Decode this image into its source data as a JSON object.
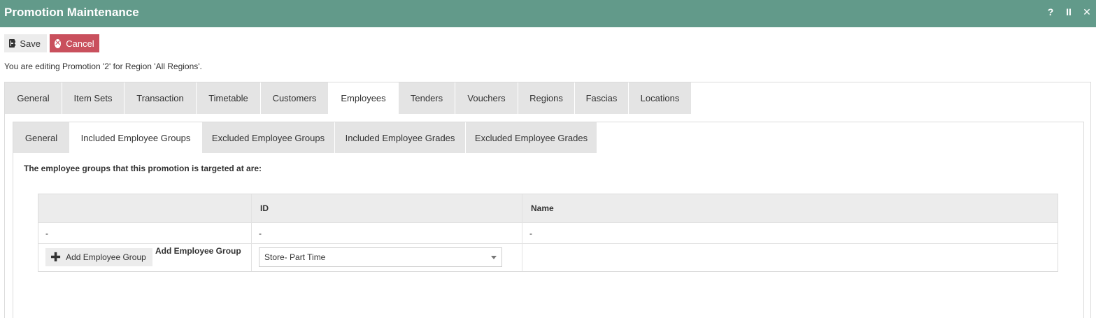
{
  "window": {
    "title": "Promotion Maintenance",
    "controls": [
      {
        "name": "help-icon",
        "glyph": "?"
      },
      {
        "name": "pause-icon",
        "glyph": "II"
      },
      {
        "name": "close-icon",
        "glyph": "✕"
      }
    ]
  },
  "toolbar": {
    "save_label": "Save",
    "save_icon": "floppy-disk-icon",
    "cancel_label": "Cancel",
    "cancel_icon": "x-circle-icon"
  },
  "notice": "You are editing Promotion '2' for Region 'All Regions'.",
  "tabs": {
    "items": [
      {
        "label": "General"
      },
      {
        "label": "Item Sets"
      },
      {
        "label": "Transaction"
      },
      {
        "label": "Timetable"
      },
      {
        "label": "Customers"
      },
      {
        "label": "Employees"
      },
      {
        "label": "Tenders"
      },
      {
        "label": "Vouchers"
      },
      {
        "label": "Regions"
      },
      {
        "label": "Fascias"
      },
      {
        "label": "Locations"
      }
    ],
    "active": "Employees"
  },
  "subtabs": {
    "items": [
      {
        "label": "General"
      },
      {
        "label": "Included Employee Groups"
      },
      {
        "label": "Excluded Employee Groups"
      },
      {
        "label": "Included Employee Grades"
      },
      {
        "label": "Excluded Employee Grades"
      }
    ],
    "active": "Included Employee Groups"
  },
  "section": {
    "heading": "The employee groups that this promotion is targeted at are:"
  },
  "table": {
    "columns": [
      "",
      "ID",
      "Name"
    ],
    "rows": [
      [
        "-",
        "-",
        "-"
      ]
    ],
    "add_button_label": "Add Employee Group",
    "add_label": "Add Employee Group",
    "select_value": "Store- Part Time"
  },
  "colors": {
    "titlebar": "#629a8a",
    "cancel": "#c9505d",
    "tab_inactive": "#e4e4e4"
  }
}
